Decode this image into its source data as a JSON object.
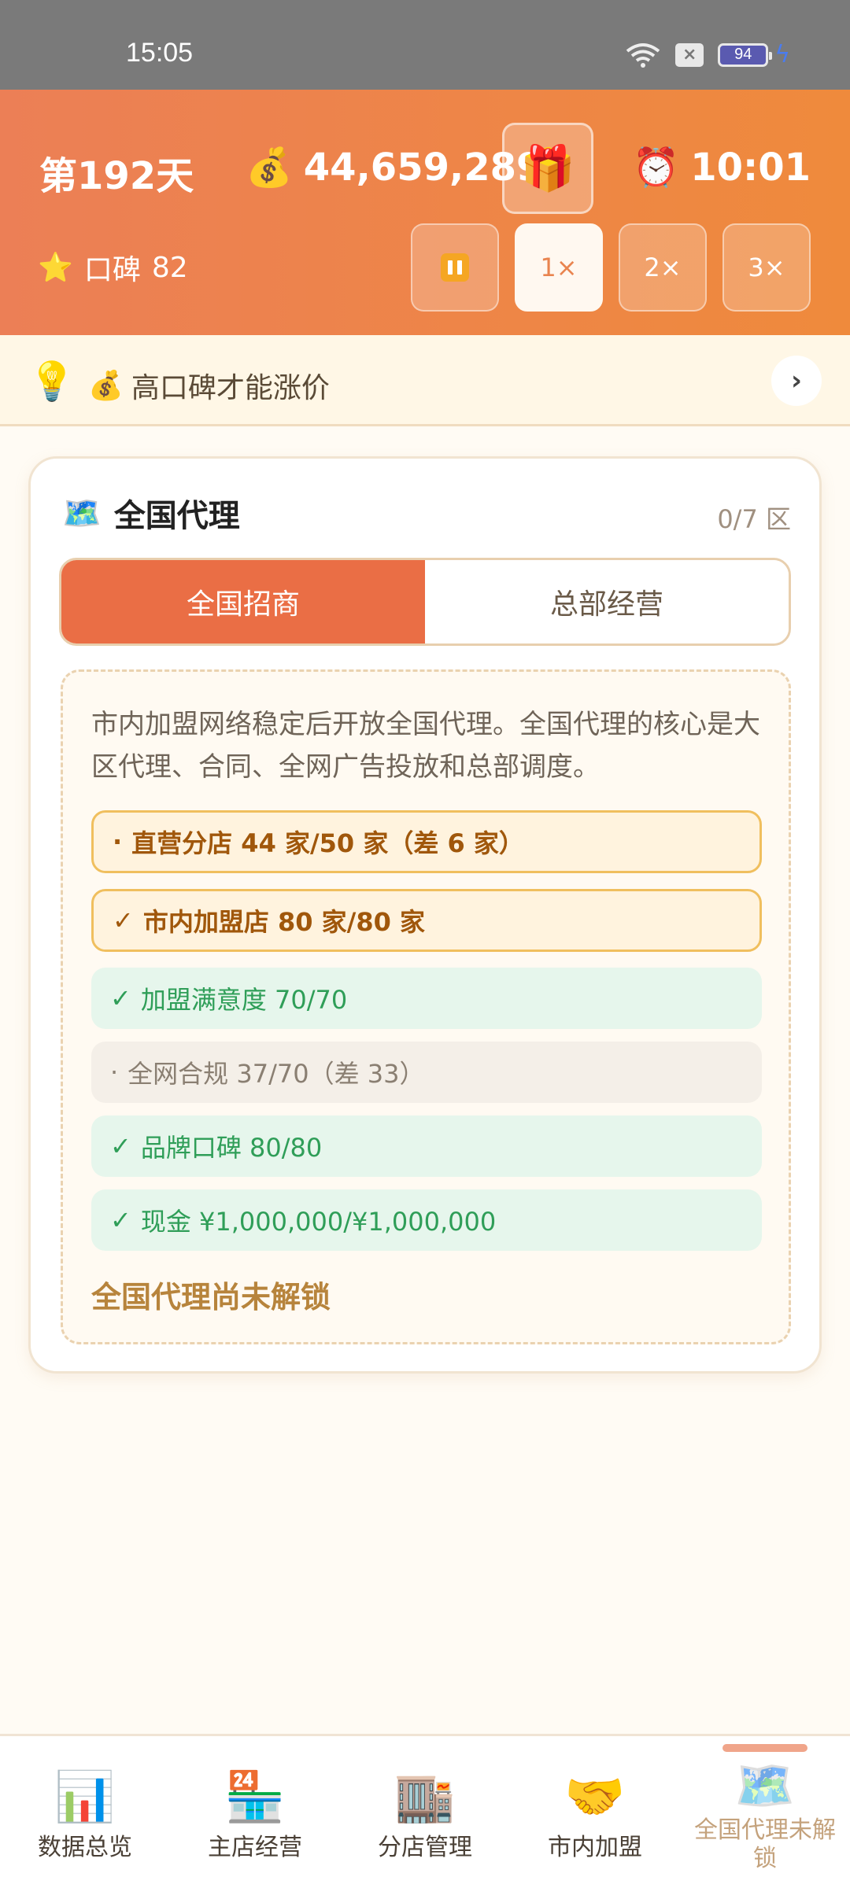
{
  "status_bar": {
    "time": "15:05",
    "battery": "94"
  },
  "header": {
    "day": "第192天",
    "money": "44,659,289",
    "clock_time": "10:01",
    "reputation_label": "口碑",
    "reputation_value": "82",
    "speeds": [
      "1×",
      "2×",
      "3×"
    ],
    "active_speed": "1×"
  },
  "tip": {
    "text": "高口碑才能涨价"
  },
  "card": {
    "title": "全国代理",
    "count": "0/7 区",
    "tabs": [
      "全国招商",
      "总部经营"
    ],
    "description": "市内加盟网络稳定后开放全国代理。全国代理的核心是大区代理、合同、全网广告投放和总部调度。",
    "requirements": [
      {
        "mark": "·",
        "text": "直营分店 44 家/50 家（差 6 家）",
        "state": "warn"
      },
      {
        "mark": "✓",
        "text": "市内加盟店 80 家/80 家",
        "state": "warn"
      },
      {
        "mark": "✓",
        "text": "加盟满意度 70/70",
        "state": "ok"
      },
      {
        "mark": "·",
        "text": "全网合规 37/70（差 33）",
        "state": "pending"
      },
      {
        "mark": "✓",
        "text": "品牌口碑 80/80",
        "state": "ok"
      },
      {
        "mark": "✓",
        "text": "现金 ¥1,000,000/¥1,000,000",
        "state": "ok"
      }
    ],
    "locked_text": "全国代理尚未解锁"
  },
  "nav": [
    {
      "label": "数据总览",
      "icon": "bar-chart-icon"
    },
    {
      "label": "主店经营",
      "icon": "store-icon"
    },
    {
      "label": "分店管理",
      "icon": "building-icon"
    },
    {
      "label": "市内加盟",
      "icon": "handshake-icon"
    },
    {
      "label": "全国代理未解锁",
      "icon": "map-icon"
    }
  ]
}
